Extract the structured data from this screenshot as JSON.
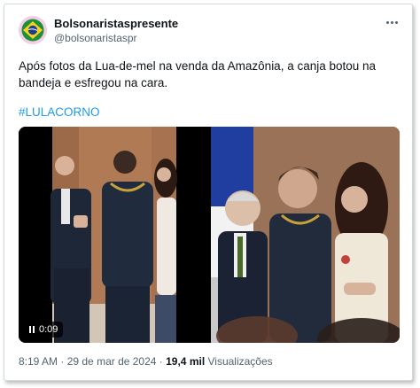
{
  "author": {
    "display_name": "Bolsonaristaspresente",
    "handle": "@bolsonaristaspr",
    "avatar": "brazil-flag-avatar"
  },
  "tweet": {
    "text": "Após fotos da Lua-de-mel na venda da Amazônia, a canja botou na bandeja e esfregou na cara.",
    "hashtag": "#LULACORNO"
  },
  "media": {
    "video_duration": "0:09",
    "left_scene": "two men and a woman in a wood-paneled room",
    "right_scene": "man leaning toward woman, flag in background"
  },
  "footer": {
    "time": "8:19 AM",
    "sep1": " · ",
    "date": "29 de mar de 2024",
    "sep2": " · ",
    "views_count": "19,4 mil",
    "views_label": "Visualizações"
  },
  "colors": {
    "link": "#1d9bf0",
    "secondary_text": "#536471",
    "border": "#cfd9de"
  }
}
